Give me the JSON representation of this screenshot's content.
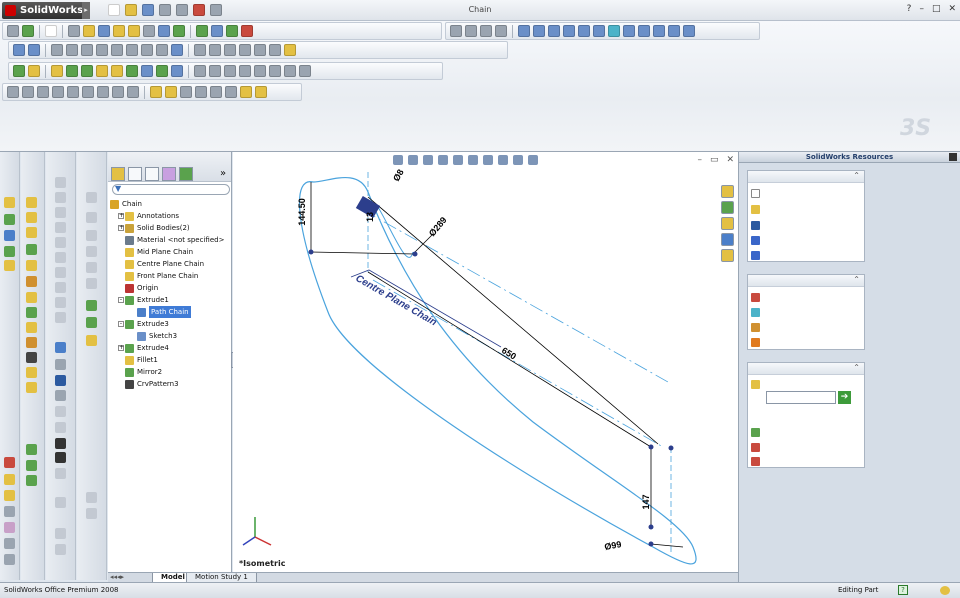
{
  "app": {
    "name": "SolidWorks",
    "document_title": "Chain",
    "window_controls": [
      "?",
      "–",
      "□",
      "✕"
    ]
  },
  "feature_tree": {
    "filter_placeholder": "",
    "nodes": [
      {
        "label": "Chain",
        "expander": "",
        "icon": "part-icon",
        "color": "#d9a425",
        "depth": 0
      },
      {
        "label": "Annotations",
        "expander": "+",
        "icon": "annotations-icon",
        "color": "#e3c043",
        "depth": 1
      },
      {
        "label": "Solid Bodies(2)",
        "expander": "+",
        "icon": "solid-bodies-icon",
        "color": "#c9a23a",
        "depth": 1
      },
      {
        "label": "Material <not specified>",
        "expander": "",
        "icon": "material-icon",
        "color": "#6b7b8c",
        "depth": 1
      },
      {
        "label": "Mid Plane Chain",
        "expander": "",
        "icon": "plane-icon",
        "color": "#e3c043",
        "depth": 1
      },
      {
        "label": "Centre Plane Chain",
        "expander": "",
        "icon": "plane-icon",
        "color": "#e3c043",
        "depth": 1
      },
      {
        "label": "Front Plane Chain",
        "expander": "",
        "icon": "plane-icon",
        "color": "#e3c043",
        "depth": 1
      },
      {
        "label": "Origin",
        "expander": "",
        "icon": "origin-icon",
        "color": "#b33",
        "depth": 1
      },
      {
        "label": "Extrude1",
        "expander": "-",
        "icon": "extrude-icon",
        "color": "#5aa24d",
        "depth": 1
      },
      {
        "label": "Path Chain",
        "expander": "",
        "icon": "sketch-icon",
        "color": "#4b7fc9",
        "depth": 2,
        "selected": true
      },
      {
        "label": "Extrude3",
        "expander": "-",
        "icon": "extrude-icon",
        "color": "#5aa24d",
        "depth": 1
      },
      {
        "label": "Sketch3",
        "expander": "",
        "icon": "sketch-icon",
        "color": "#6a8fc8",
        "depth": 2
      },
      {
        "label": "Extrude4",
        "expander": "+",
        "icon": "extrude-icon",
        "color": "#5aa24d",
        "depth": 1
      },
      {
        "label": "Fillet1",
        "expander": "",
        "icon": "fillet-icon",
        "color": "#e3c043",
        "depth": 1
      },
      {
        "label": "Mirror2",
        "expander": "",
        "icon": "mirror-icon",
        "color": "#5aa24d",
        "depth": 1
      },
      {
        "label": "CrvPattern3",
        "expander": "",
        "icon": "curve-pattern-icon",
        "color": "#444",
        "depth": 1
      }
    ]
  },
  "viewport": {
    "view_label": "*Isometric",
    "dimensions": [
      "144.50",
      "Ø8",
      "13",
      "Ø289",
      "650",
      "147",
      "Ø99"
    ],
    "plane_label": "Centre Plane Chain",
    "colors": {
      "profile": "#4aa3dd",
      "dim": "#000",
      "plane": "#2c3e8c"
    }
  },
  "bottom_tabs": [
    "Model",
    "Motion Study 1"
  ],
  "task_pane": {
    "title": "SolidWorks Resources"
  },
  "status": {
    "left": "SolidWorks Office Premium 2008",
    "editing": "Editing Part",
    "help": "?"
  }
}
